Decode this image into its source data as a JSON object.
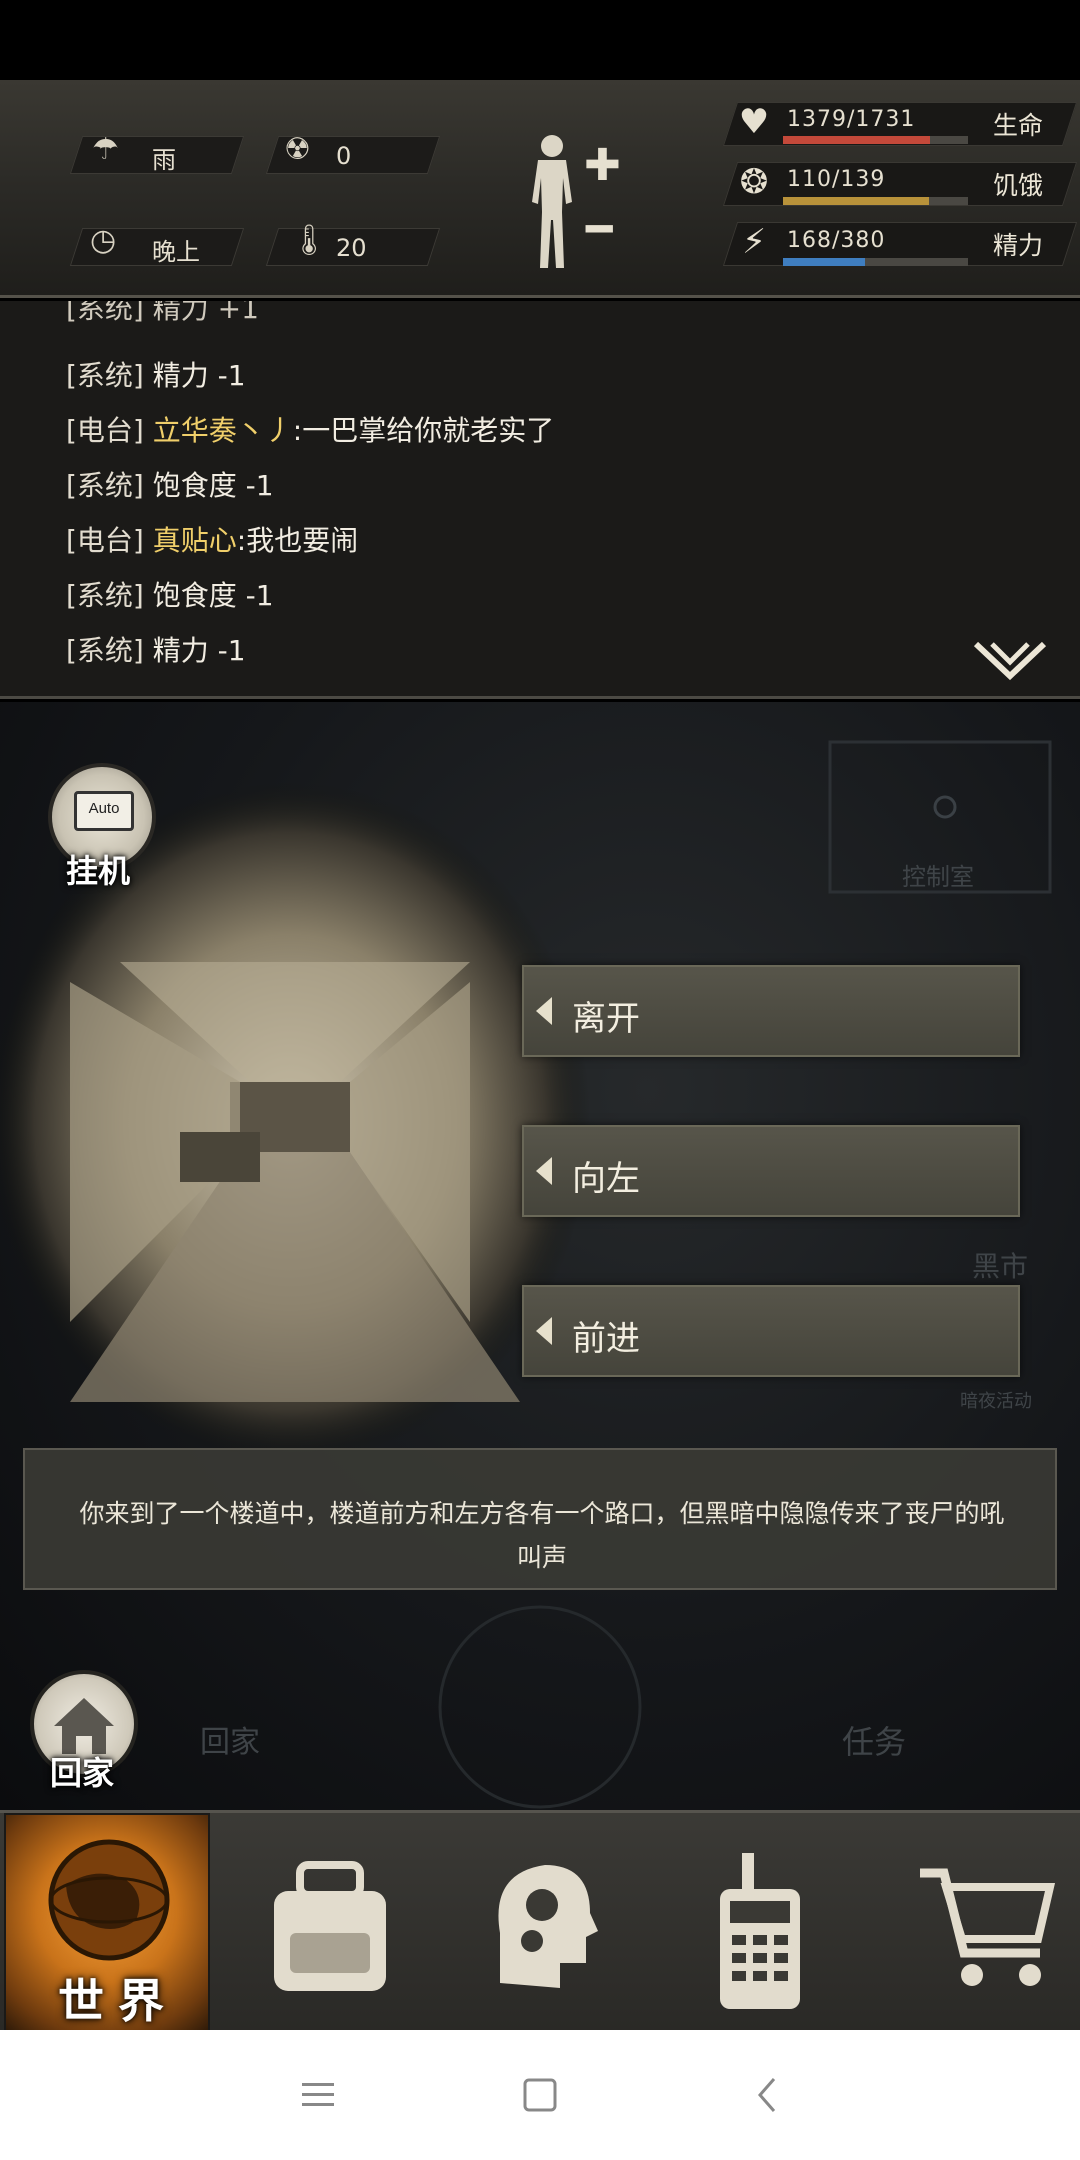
{
  "hud": {
    "weather": {
      "icon": "rain-cloud-icon",
      "label": "雨"
    },
    "radiation": {
      "icon": "radiation-icon",
      "value": "0"
    },
    "time": {
      "icon": "clock-icon",
      "label": "晚上"
    },
    "temperature": {
      "icon": "thermometer-icon",
      "value": "20"
    },
    "stats": [
      {
        "icon": "heart-pulse-icon",
        "value": "1379/1731",
        "label": "生命",
        "fraction": 0.797,
        "color": "#c4493a"
      },
      {
        "icon": "stomach-icon",
        "value": "110/139",
        "label": "饥饿",
        "fraction": 0.791,
        "color": "#b8923a"
      },
      {
        "icon": "energy-head-icon",
        "value": "168/380",
        "label": "精力",
        "fraction": 0.442,
        "color": "#3f7ec0"
      }
    ]
  },
  "chat": {
    "partial_line": "[系统] 精力 +1",
    "lines": [
      {
        "channel": "[系统]",
        "name": "",
        "message": "精力 -1"
      },
      {
        "channel": "[电台]",
        "name": "立华奏丶丿",
        "message": ":一巴掌给你就老实了"
      },
      {
        "channel": "[系统]",
        "name": "",
        "message": "饱食度 -1"
      },
      {
        "channel": "[电台]",
        "name": "真贴心",
        "message": ":我也要闹"
      },
      {
        "channel": "[系统]",
        "name": "",
        "message": "饱食度 -1"
      },
      {
        "channel": "[系统]",
        "name": "",
        "message": "精力 -1"
      }
    ]
  },
  "scene": {
    "auto_button": {
      "icon_text": "Auto",
      "label": "挂机"
    },
    "dim_labels": {
      "control_room": "控制室",
      "black_market": "黑市",
      "event": "暗夜活动",
      "tasks": "任务",
      "home": "回家"
    },
    "choices": [
      "离开",
      "向左",
      "前进"
    ],
    "narration": "你来到了一个楼道中，楼道前方和左方各有一个路口，但黑暗中隐隐传来了丧尸的吼叫声",
    "home_button": {
      "label": "回家"
    }
  },
  "bottom_nav": {
    "world_label": "世界",
    "items": [
      "globe-icon",
      "backpack-icon",
      "skills-head-icon",
      "radio-icon",
      "cart-icon"
    ]
  }
}
